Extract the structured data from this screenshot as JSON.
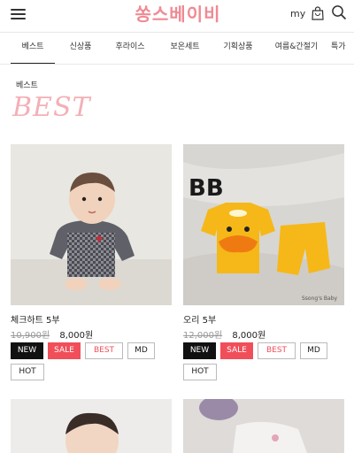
{
  "header": {
    "logo_text": "쏭스베이비",
    "my_label": "my",
    "icons": [
      "menu-icon",
      "bag-icon",
      "search-icon"
    ]
  },
  "tabs": [
    {
      "label": "베스트",
      "active": true
    },
    {
      "label": "신상품"
    },
    {
      "label": "후라이스"
    },
    {
      "label": "보온세트"
    },
    {
      "label": "기획상품"
    },
    {
      "label": "여름&간절기"
    },
    {
      "label": "특가"
    }
  ],
  "section": {
    "label": "베스트",
    "title": "BEST"
  },
  "products": [
    {
      "name": "체크하트 5부",
      "original_price": "10,900원",
      "price": "8,000원",
      "badges": [
        "NEW",
        "SALE",
        "BEST",
        "MD",
        "HOT"
      ]
    },
    {
      "name": "오리 5부",
      "original_price": "12,000원",
      "price": "8,000원",
      "badges": [
        "NEW",
        "SALE",
        "BEST",
        "MD",
        "HOT"
      ],
      "image_text": "BB",
      "watermark": "Ssong's Baby"
    }
  ],
  "colors": {
    "logo": "#f08a93",
    "best_title": "#f3b0b6",
    "sale_badge": "#f04f5a",
    "new_badge": "#111111"
  }
}
